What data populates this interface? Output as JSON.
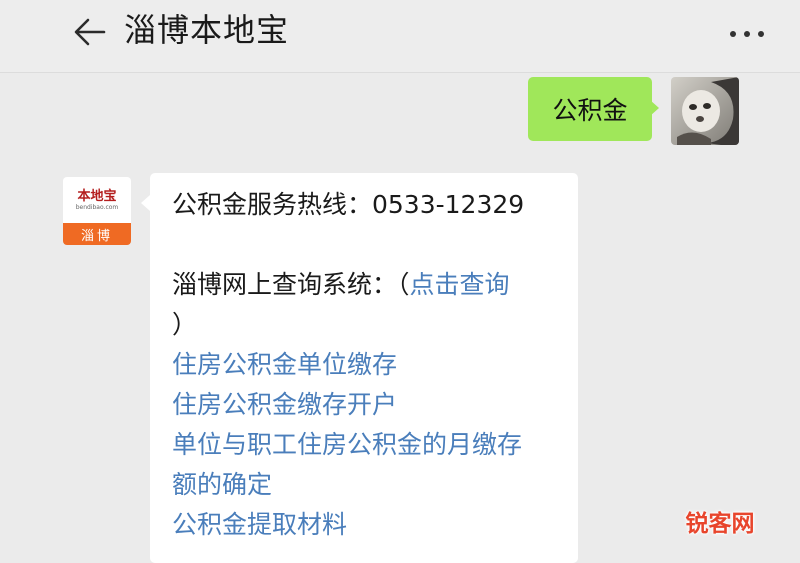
{
  "header": {
    "title": "淄博本地宝",
    "back_icon": "arrow-left-icon",
    "more_icon": "more-dots-icon"
  },
  "messages": {
    "outgoing": {
      "text": "公积金",
      "bubble_color": "#a0e75a"
    },
    "incoming": {
      "avatar": {
        "brand": "本地宝",
        "url": "bendibao.com",
        "city": "淄博",
        "accent_color": "#ef6a23"
      },
      "hotline": "公积金服务热线：0533-12329",
      "query_prefix": "淄博网上查询系统：（",
      "query_link": "点击查询",
      "query_suffix": "）",
      "links": [
        "住房公积金单位缴存",
        "住房公积金缴存开户",
        "单位与职工住房公积金的月缴存",
        "额的确定",
        "公积金提取材料"
      ],
      "link_color": "#4a7ebb"
    }
  },
  "watermark": "锐客网"
}
